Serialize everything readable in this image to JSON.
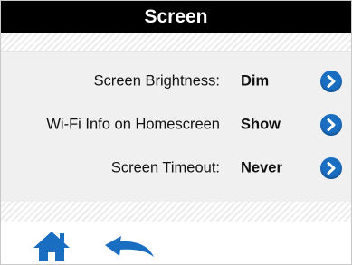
{
  "header": {
    "title": "Screen"
  },
  "settings": [
    {
      "label": "Screen Brightness:",
      "value": "Dim",
      "action_icon": "chevron-right-icon"
    },
    {
      "label": "Wi-Fi Info on Homescreen",
      "value": "Show",
      "action_icon": "chevron-right-icon"
    },
    {
      "label": "Screen Timeout:",
      "value": "Never",
      "action_icon": "chevron-right-icon"
    }
  ],
  "nav": {
    "home_icon": "home-icon",
    "back_icon": "back-arrow-icon"
  },
  "colors": {
    "title_bar": "#000000",
    "title_text": "#ffffff",
    "panel": "#f0f0f0",
    "accent": "#1a6ec2"
  }
}
